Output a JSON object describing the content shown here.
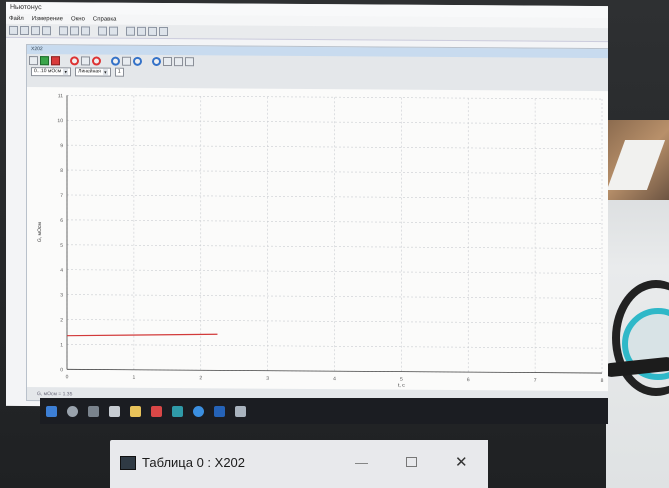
{
  "app": {
    "window_title": "Ньютонус",
    "menu": [
      "Файл",
      "Измерение",
      "Окно",
      "Справка"
    ]
  },
  "subwindow": {
    "title": "X202",
    "scale_select": "0...10 мОсм",
    "mode_select": "Линейная",
    "count_value": "1"
  },
  "chart_data": {
    "type": "line",
    "ylabel": "G, мОсм",
    "xlabel": "t, c",
    "xlim": [
      0,
      8
    ],
    "ylim": [
      0,
      11
    ],
    "x_ticks": [
      "0",
      "1",
      "2",
      "3",
      "4",
      "5",
      "6",
      "7",
      "8"
    ],
    "y_ticks": [
      "0",
      "1",
      "2",
      "3",
      "4",
      "5",
      "6",
      "7",
      "8",
      "9",
      "10",
      "11"
    ],
    "grid": true,
    "series": [
      {
        "color": "#d23a3a",
        "x": [
          0,
          2.25
        ],
        "y": [
          1.35,
          1.45
        ]
      }
    ]
  },
  "status": {
    "text": "G, мОсм = 1.35"
  },
  "taskbar": {
    "icons": [
      "windows-start",
      "search",
      "task-view",
      "store",
      "file-explorer",
      "app-red",
      "app-teal",
      "edge",
      "app-blue",
      "app-active"
    ]
  },
  "overlay_window": {
    "title": "Таблица 0 : X202",
    "minimize": "—",
    "close": "✕"
  }
}
